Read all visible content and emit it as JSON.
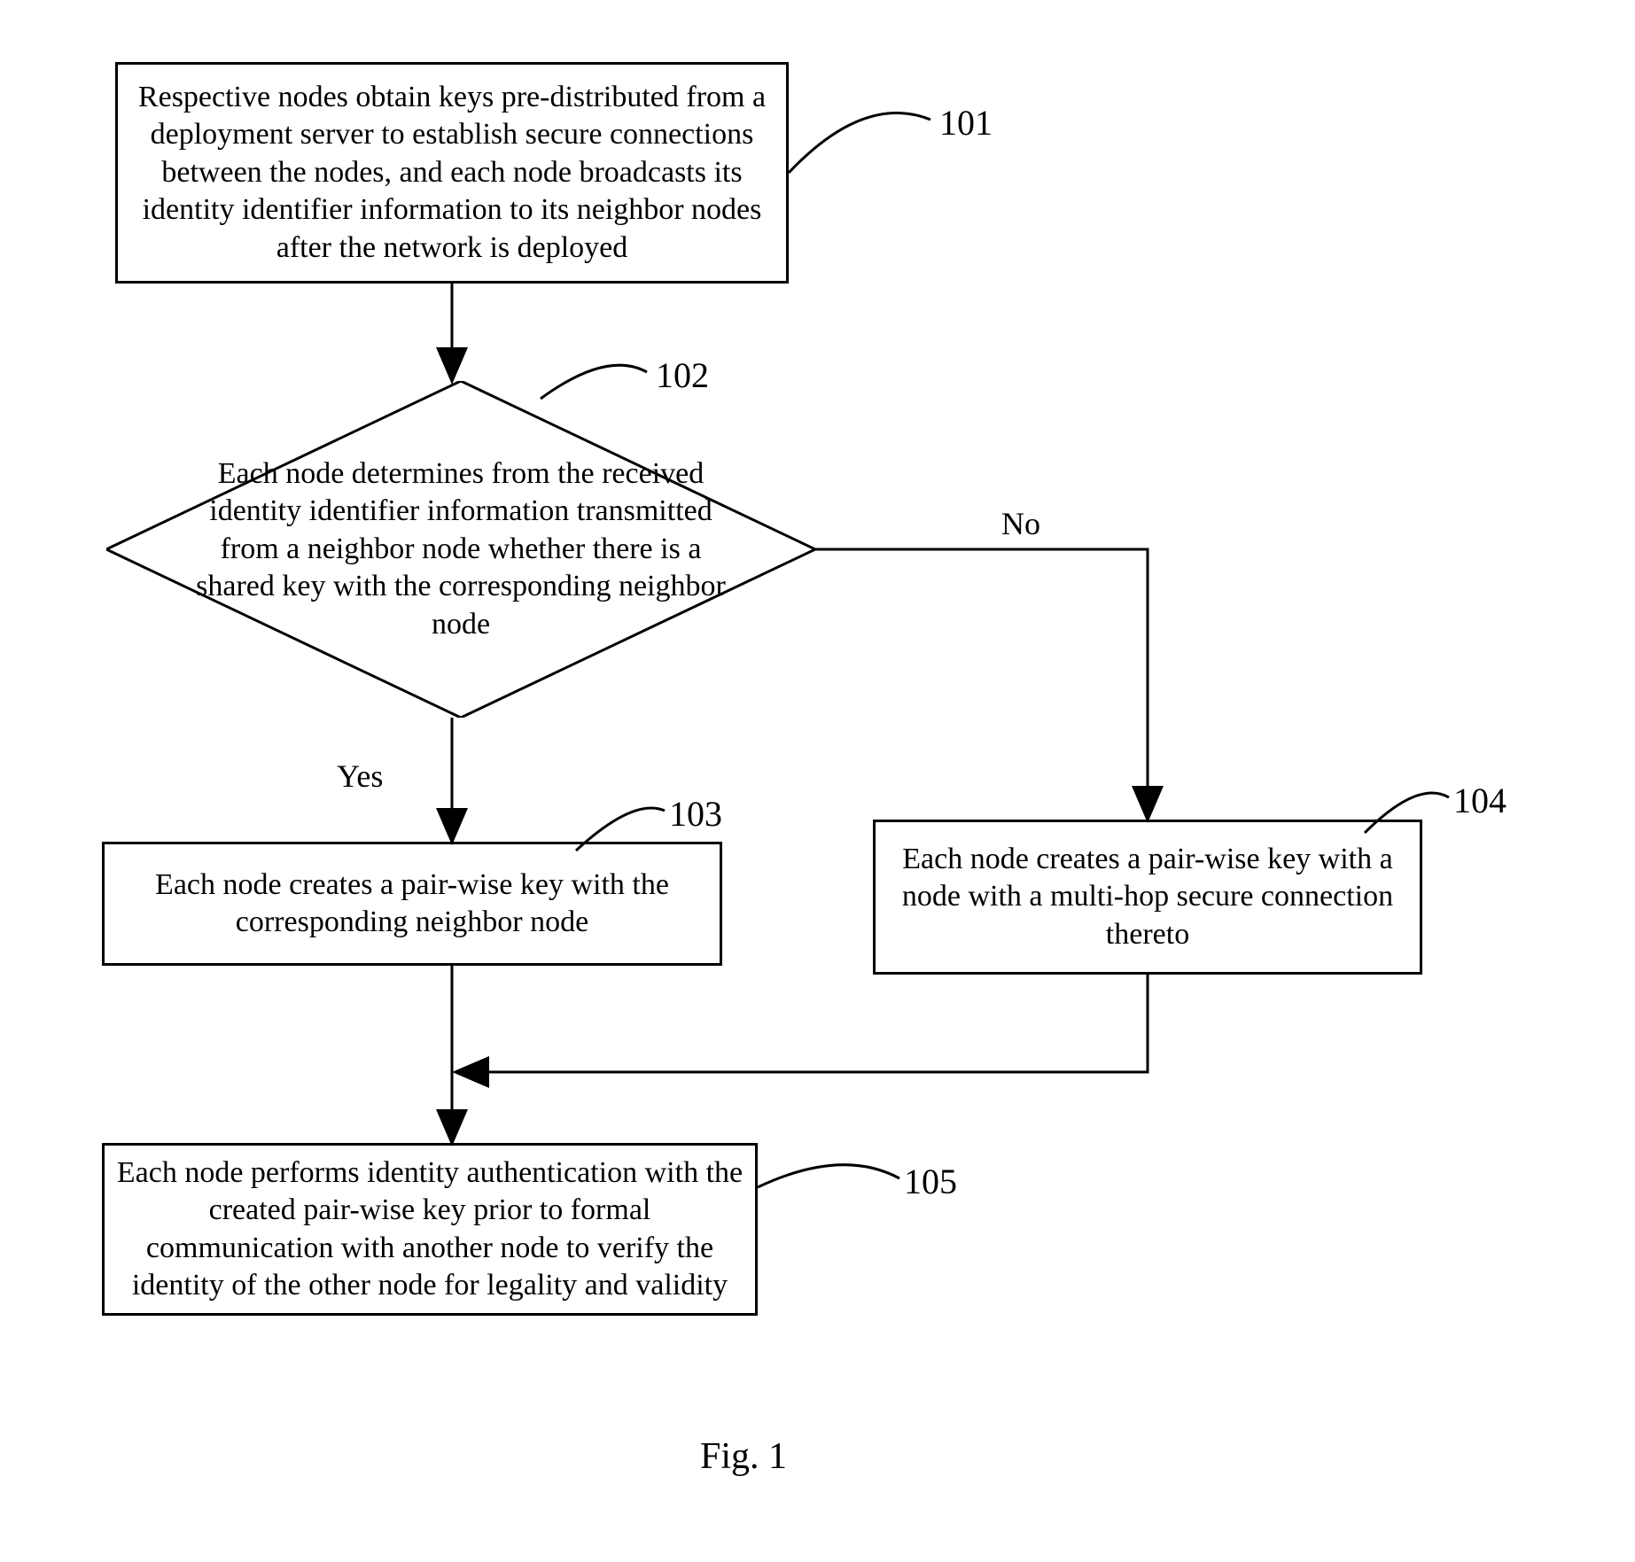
{
  "steps": {
    "s101": {
      "num": "101",
      "text": "Respective nodes obtain keys pre-distributed from a deployment server to establish secure connections between the nodes, and each node broadcasts its identity identifier information to its neighbor nodes after the network is deployed"
    },
    "s102": {
      "num": "102",
      "text": "Each node determines from the received identity identifier information transmitted from a neighbor node whether there is a shared key with the corresponding neighbor node"
    },
    "s103": {
      "num": "103",
      "text": "Each node creates a pair-wise key with the corresponding neighbor node"
    },
    "s104": {
      "num": "104",
      "text": "Each node creates a pair-wise key with a node with a multi-hop secure connection thereto"
    },
    "s105": {
      "num": "105",
      "text": "Each node performs identity authentication with the created pair-wise key prior to formal communication with another node to verify the identity of the other node for legality and validity"
    }
  },
  "labels": {
    "yes": "Yes",
    "no": "No"
  },
  "caption": "Fig. 1",
  "chart_data": {
    "type": "flowchart",
    "nodes": [
      {
        "id": "101",
        "shape": "process",
        "text": "Respective nodes obtain keys pre-distributed from a deployment server to establish secure connections between the nodes, and each node broadcasts its identity identifier information to its neighbor nodes after the network is deployed"
      },
      {
        "id": "102",
        "shape": "decision",
        "text": "Each node determines from the received identity identifier information transmitted from a neighbor node whether there is a shared key with the corresponding neighbor node"
      },
      {
        "id": "103",
        "shape": "process",
        "text": "Each node creates a pair-wise key with the corresponding neighbor node"
      },
      {
        "id": "104",
        "shape": "process",
        "text": "Each node creates a pair-wise key with a node with a multi-hop secure connection thereto"
      },
      {
        "id": "105",
        "shape": "process",
        "text": "Each node performs identity authentication with the created pair-wise key prior to formal communication with another node to verify the identity of the other node for legality and validity"
      }
    ],
    "edges": [
      {
        "from": "101",
        "to": "102",
        "label": ""
      },
      {
        "from": "102",
        "to": "103",
        "label": "Yes"
      },
      {
        "from": "102",
        "to": "104",
        "label": "No"
      },
      {
        "from": "103",
        "to": "105",
        "label": ""
      },
      {
        "from": "104",
        "to": "105",
        "label": ""
      }
    ]
  }
}
